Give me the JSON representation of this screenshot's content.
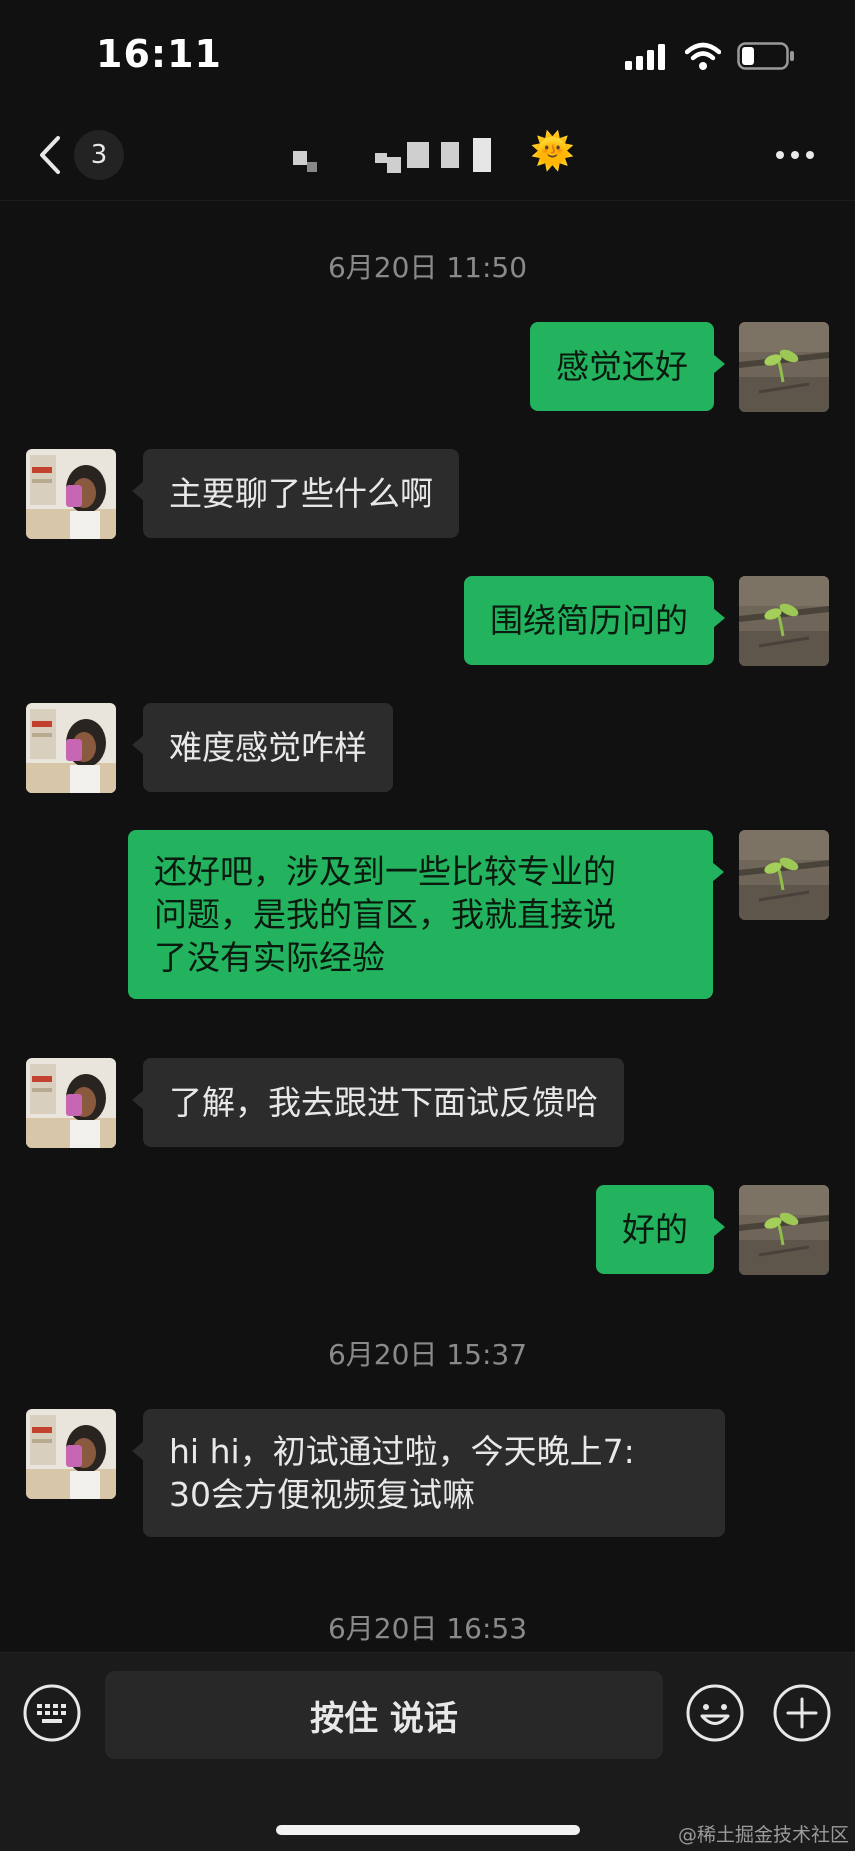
{
  "status_bar": {
    "time": "16:11"
  },
  "header": {
    "unread_count": "3",
    "more_icon": "ellipsis-icon",
    "title_emoji": "🌞"
  },
  "messages": [
    {
      "type": "timestamp",
      "text": "6月20日 11:50"
    },
    {
      "type": "outgoing",
      "text": "感觉还好"
    },
    {
      "type": "incoming",
      "text": "主要聊了些什么啊"
    },
    {
      "type": "outgoing",
      "text": "围绕简历问的"
    },
    {
      "type": "incoming",
      "text": "难度感觉咋样"
    },
    {
      "type": "outgoing",
      "lines": [
        "还好吧，涉及到一些比较专业的",
        "问题，是我的盲区，我就直接说",
        "了没有实际经验"
      ]
    },
    {
      "type": "incoming",
      "text": "了解，我去跟进下面试反馈哈"
    },
    {
      "type": "outgoing",
      "text": "好的"
    },
    {
      "type": "timestamp",
      "text": "6月20日 15:37"
    },
    {
      "type": "incoming",
      "lines": [
        "hi hi，初试通过啦，今天晚上7:",
        "30会方便视频复试嘛"
      ]
    },
    {
      "type": "timestamp",
      "text": "6月20日 16:53"
    }
  ],
  "input_bar": {
    "hold_to_talk": "按住 说话",
    "icons": [
      "keyboard-icon",
      "emoji-icon",
      "plus-icon"
    ]
  },
  "watermark": "@稀土掘金技术社区",
  "colors": {
    "background": "#111111",
    "outgoing_bubble": "#23b35e",
    "incoming_bubble": "#2c2c2c"
  }
}
